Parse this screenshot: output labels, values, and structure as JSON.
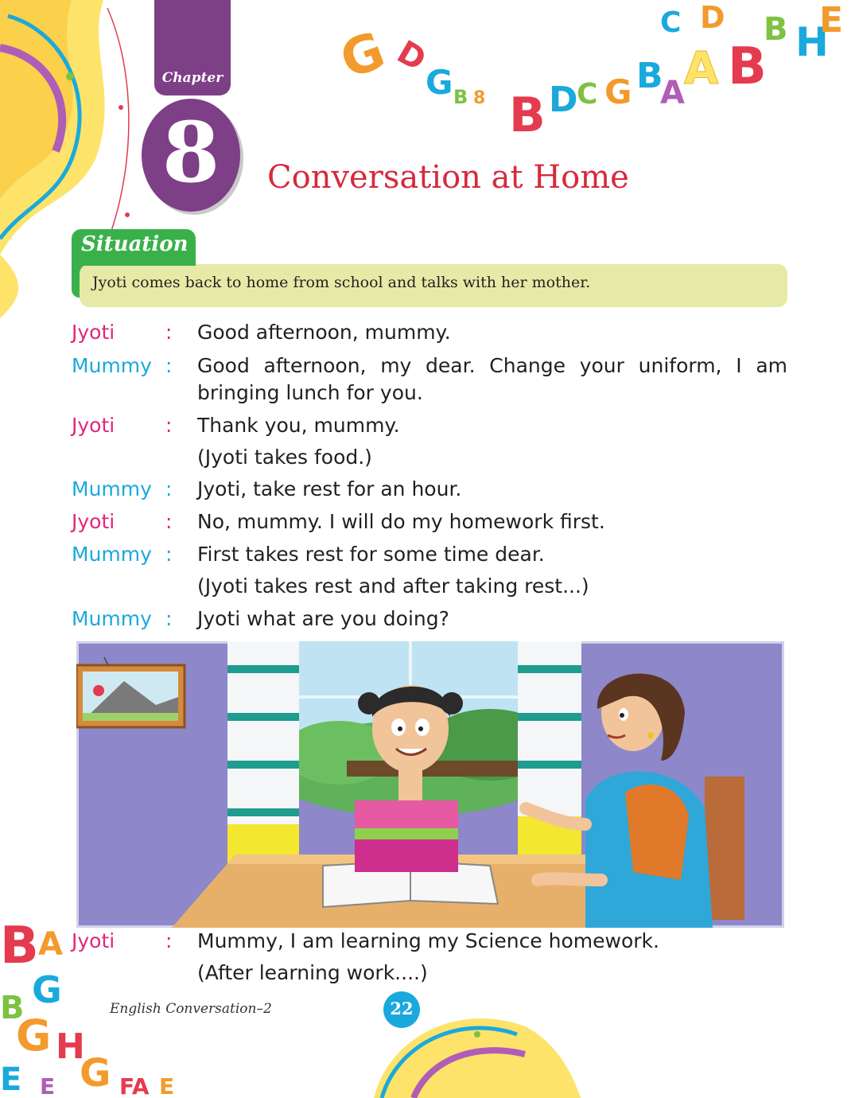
{
  "chapter": {
    "label": "Chapter",
    "number": "8"
  },
  "title": "Conversation at Home",
  "situation": {
    "label": "Situation",
    "text": "Jyoti comes back to home from school and talks with her mother."
  },
  "dialogue_top": [
    {
      "speaker": "Jyoti",
      "colon": ":",
      "line1": "Good afternoon, mummy."
    },
    {
      "speaker": "Mummy",
      "colon": ":",
      "line1": "Good afternoon, my dear. Change your uniform, I am",
      "line2": "bringing lunch for you."
    },
    {
      "speaker": "Jyoti",
      "colon": ":",
      "line1": "Thank you, mummy."
    },
    {
      "line1": "(Jyoti takes food.)"
    },
    {
      "speaker": "Mummy",
      "colon": ":",
      "line1": "Jyoti, take rest for an hour."
    },
    {
      "speaker": "Jyoti",
      "colon": ":",
      "line1": "No, mummy. I will do my homework first."
    },
    {
      "speaker": "Mummy",
      "colon": ":",
      "line1": "First takes rest for some time dear."
    },
    {
      "line1": "(Jyoti takes rest and after taking rest...)"
    },
    {
      "speaker": "Mummy",
      "colon": ":",
      "line1": "Jyoti what are you doing?"
    }
  ],
  "dialogue_bottom": [
    {
      "speaker": "Jyoti",
      "colon": ":",
      "line1": "Mummy, I am learning my Science homework."
    },
    {
      "line1": "(After learning work....)"
    }
  ],
  "footer": {
    "book": "English Conversation–2",
    "page": "22"
  },
  "colors": {
    "jyoti": "#e0267b",
    "mummy": "#1aa9dc",
    "title": "#d62a3c",
    "chapter": "#7d3f86",
    "situation": "#3ab04a",
    "situation_box": "#e7eaa6"
  },
  "illustration": {
    "description_icon": "mother-daughter-homework-illustration"
  }
}
